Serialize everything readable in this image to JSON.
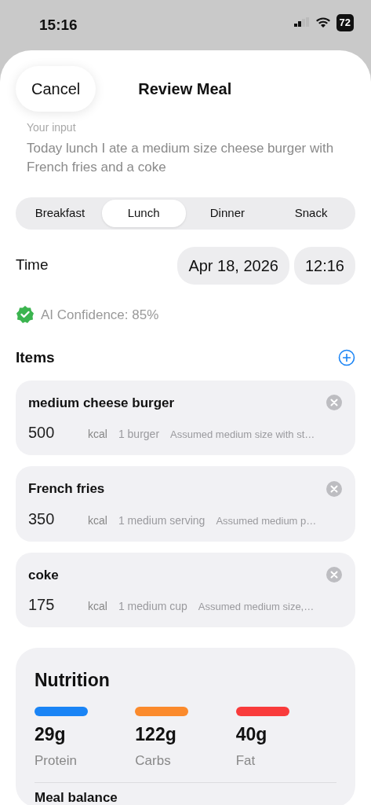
{
  "status_bar": {
    "time": "15:16",
    "battery": "72"
  },
  "header": {
    "cancel": "Cancel",
    "title": "Review Meal"
  },
  "input": {
    "label": "Your input",
    "text": "Today lunch I ate a medium size cheese burger with French fries and a coke"
  },
  "meal_types": [
    {
      "label": "Breakfast",
      "selected": false
    },
    {
      "label": "Lunch",
      "selected": true
    },
    {
      "label": "Dinner",
      "selected": false
    },
    {
      "label": "Snack",
      "selected": false
    }
  ],
  "time": {
    "label": "Time",
    "date": "Apr 18, 2026",
    "clock": "12:16"
  },
  "confidence": "AI Confidence: 85%",
  "items_title": "Items",
  "items": [
    {
      "name": "medium cheese burger",
      "calories": "500",
      "unit": "kcal",
      "portion": "1 burger",
      "note": "Assumed medium size with st…"
    },
    {
      "name": "French fries",
      "calories": "350",
      "unit": "kcal",
      "portion": "1 medium serving",
      "note": "Assumed medium p…"
    },
    {
      "name": "coke",
      "calories": "175",
      "unit": "kcal",
      "portion": "1 medium cup",
      "note": "Assumed medium size,…"
    }
  ],
  "nutrition": {
    "title": "Nutrition",
    "macros": [
      {
        "value": "29g",
        "label": "Protein",
        "color": "#1a84f5"
      },
      {
        "value": "122g",
        "label": "Carbs",
        "color": "#fb8a2c"
      },
      {
        "value": "40g",
        "label": "Fat",
        "color": "#f93b3b"
      }
    ],
    "next_section": "Meal balance"
  }
}
